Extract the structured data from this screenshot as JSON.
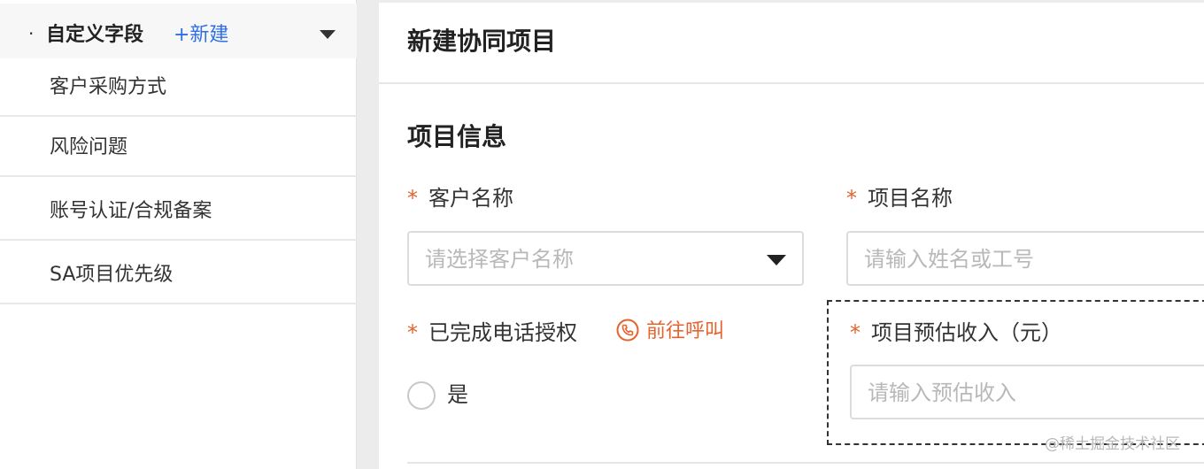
{
  "sidebar": {
    "dot": "·",
    "title": "自定义字段",
    "new_link": "+新建",
    "items": [
      {
        "label": "客户采购方式"
      },
      {
        "label": "风险问题"
      },
      {
        "label": "账号认证/合规备案"
      },
      {
        "label": "SA项目优先级"
      }
    ]
  },
  "panel": {
    "title": "新建协同项目",
    "section_title": "项目信息",
    "required_mark": "*",
    "fields": {
      "customer_name": {
        "label": "客户名称",
        "placeholder": "请选择客户名称"
      },
      "project_name": {
        "label": "项目名称",
        "placeholder": "请输入姓名或工号"
      },
      "phone_auth": {
        "label": "已完成电话授权",
        "call_link": "前往呼叫",
        "option": "是"
      },
      "estimated_income": {
        "label": "项目预估收入（元）",
        "placeholder": "请输入预估收入"
      }
    }
  },
  "watermark": "@稀土掘金技术社区",
  "colors": {
    "accent": "#e8622c",
    "link": "#2f6fe6"
  },
  "icons": {
    "sidebar_caret": "caret-down-icon",
    "select_caret": "caret-down-icon",
    "call": "phone-icon"
  }
}
